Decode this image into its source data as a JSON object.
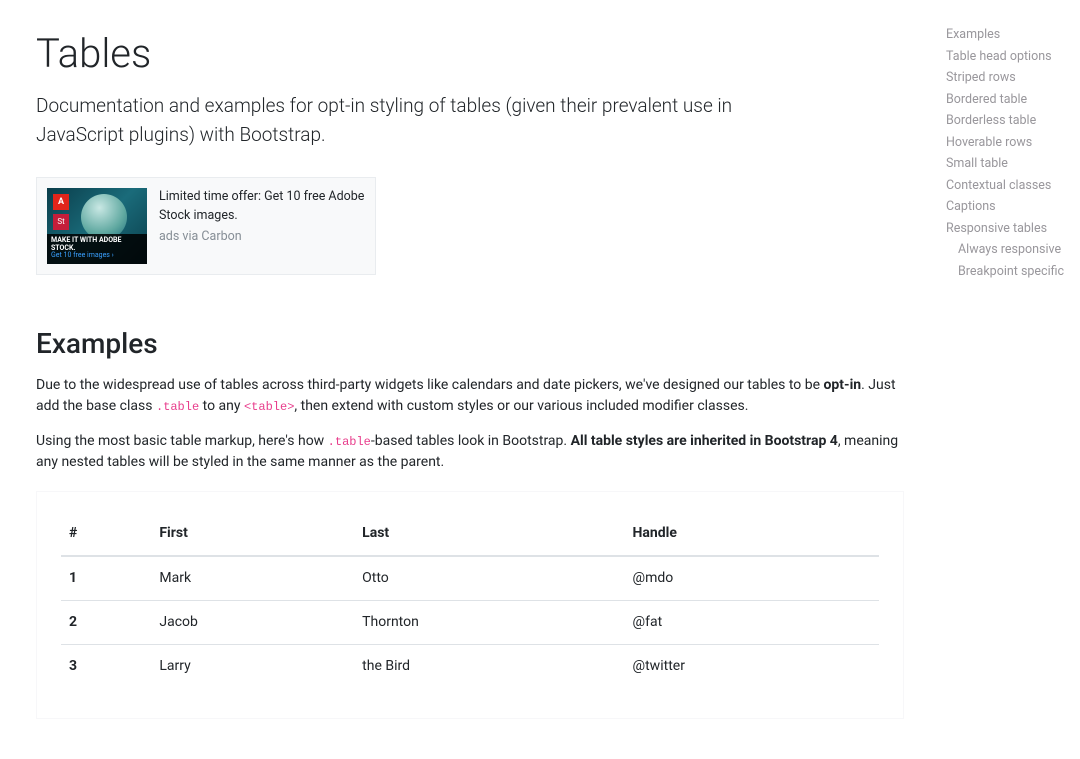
{
  "page": {
    "title": "Tables",
    "lead": "Documentation and examples for opt-in styling of tables (given their prevalent use in JavaScript plugins) with Bootstrap."
  },
  "ad": {
    "logo_glyph": "A",
    "st_glyph": "St",
    "overlay_line1": "MAKE IT WITH ADOBE STOCK.",
    "overlay_line2": "Get 10 free images ›",
    "copy": "Limited time offer: Get 10 free Adobe Stock images.",
    "attribution": "ads via Carbon"
  },
  "section": {
    "title": "Examples",
    "p1_a": "Due to the widespread use of tables across third-party widgets like calendars and date pickers, we've designed our tables to be ",
    "p1_b_strong": "opt-in",
    "p1_c": ". Just add the base class ",
    "p1_code1": ".table",
    "p1_d": " to any ",
    "p1_code2": "<table>",
    "p1_e": ", then extend with custom styles or our various included modifier classes.",
    "p2_a": "Using the most basic table markup, here's how ",
    "p2_code1": ".table",
    "p2_b": "-based tables look in Bootstrap. ",
    "p2_strong": "All table styles are inherited in Bootstrap 4",
    "p2_c": ", meaning any nested tables will be styled in the same manner as the parent."
  },
  "table": {
    "headers": {
      "c0": "#",
      "c1": "First",
      "c2": "Last",
      "c3": "Handle"
    },
    "rows": [
      {
        "n": "1",
        "first": "Mark",
        "last": "Otto",
        "handle": "@mdo"
      },
      {
        "n": "2",
        "first": "Jacob",
        "last": "Thornton",
        "handle": "@fat"
      },
      {
        "n": "3",
        "first": "Larry",
        "last": "the Bird",
        "handle": "@twitter"
      }
    ]
  },
  "toc": {
    "items": [
      "Examples",
      "Table head options",
      "Striped rows",
      "Bordered table",
      "Borderless table",
      "Hoverable rows",
      "Small table",
      "Contextual classes",
      "Captions",
      "Responsive tables"
    ],
    "sub": [
      "Always responsive",
      "Breakpoint specific"
    ]
  }
}
